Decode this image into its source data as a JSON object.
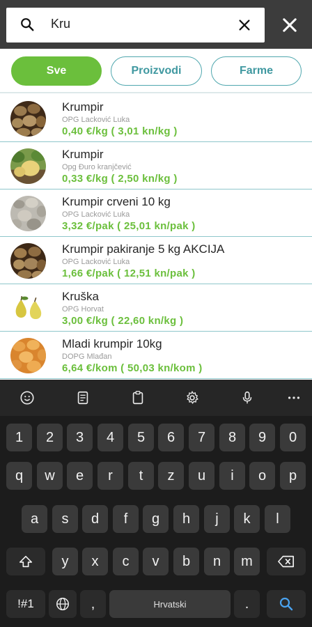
{
  "search": {
    "value": "Kru"
  },
  "tabs": [
    {
      "label": "Sve",
      "active": true
    },
    {
      "label": "Proizvodi",
      "active": false
    },
    {
      "label": "Farme",
      "active": false
    }
  ],
  "results": [
    {
      "name": "Krumpir",
      "seller": "OPG Lacković Luka",
      "price": "0,40 €/kg ( 3,01 kn/kg )",
      "thumb": "potatoes"
    },
    {
      "name": "Krumpir",
      "seller": "Opg Đuro kranjčević",
      "price": "0,33 €/kg ( 2,50 kn/kg )",
      "thumb": "potato-plant"
    },
    {
      "name": "Krumpir crveni 10 kg",
      "seller": "OPG Lacković Luka",
      "price": "3,32 €/pak ( 25,01 kn/pak )",
      "thumb": "potato-sack"
    },
    {
      "name": "Krumpir pakiranje 5 kg AKCIJA",
      "seller": "OPG Lacković Luka",
      "price": "1,66 €/pak ( 12,51 kn/pak )",
      "thumb": "potatoes"
    },
    {
      "name": "Kruška",
      "seller": "OPG Horvat",
      "price": "3,00 €/kg ( 22,60 kn/kg )",
      "thumb": "pears"
    },
    {
      "name": "Mladi krumpir 10kg",
      "seller": "DOPG Mlađan",
      "price": "6,64 €/kom ( 50,03 kn/kom )",
      "thumb": "young-potatoes"
    }
  ],
  "keyboard": {
    "toolbar": [
      "emoji-icon",
      "clipboard-icon",
      "clipboard-history-icon",
      "settings-icon",
      "microphone-icon",
      "more-icon"
    ],
    "row_numbers": [
      "1",
      "2",
      "3",
      "4",
      "5",
      "6",
      "7",
      "8",
      "9",
      "0"
    ],
    "row1": [
      "q",
      "w",
      "e",
      "r",
      "t",
      "z",
      "u",
      "i",
      "o",
      "p"
    ],
    "row2": [
      "a",
      "s",
      "d",
      "f",
      "g",
      "h",
      "j",
      "k",
      "l"
    ],
    "row3": [
      "y",
      "x",
      "c",
      "v",
      "b",
      "n",
      "m"
    ],
    "symbols_key": "!#1",
    "comma_key": ",",
    "space_label": "Hrvatski",
    "period_key": "."
  }
}
